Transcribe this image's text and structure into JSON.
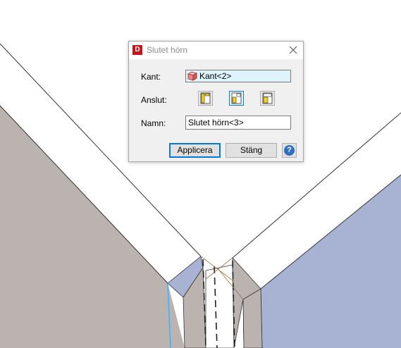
{
  "dialog": {
    "title": "Slutet hörn",
    "app_logo_letter": "D",
    "kant": {
      "label": "Kant:",
      "value": "Kant<2>"
    },
    "anslut": {
      "label": "Anslut:",
      "options": [
        "anslut-option-1",
        "anslut-option-2",
        "anslut-option-3"
      ],
      "selected_index": 1
    },
    "namn": {
      "label": "Namn:",
      "value": "Slutet hörn<3>"
    },
    "buttons": {
      "apply": "Applicera",
      "close": "Stäng",
      "help": "?"
    }
  },
  "colors": {
    "left_wall": "#bbb3b0",
    "right_wall": "#a8b3d3",
    "top_surface": "#ffffff",
    "selection_blue": "#0078d7",
    "app_red": "#c4161c",
    "help_blue": "#2f6fbd"
  }
}
